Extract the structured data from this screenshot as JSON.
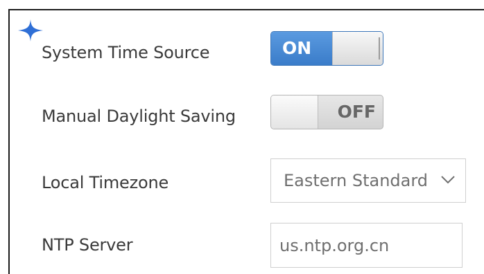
{
  "settings": {
    "system_time_source": {
      "label": "System Time Source",
      "toggle_label": "ON",
      "state": "on"
    },
    "manual_daylight_saving": {
      "label": "Manual Daylight Saving",
      "toggle_label": "OFF",
      "state": "off"
    },
    "local_timezone": {
      "label": "Local Timezone",
      "selected_value": "Eastern Standard"
    },
    "ntp_server": {
      "label": "NTP Server",
      "value": "us.ntp.org.cn"
    }
  },
  "icons": {
    "sparkle": "sparkle-icon",
    "dropdown": "chevron-down-icon"
  },
  "colors": {
    "toggle_on": "#3a7cc9",
    "sparkle": "#2f6fd6",
    "frame_border": "#1b1b1b"
  }
}
